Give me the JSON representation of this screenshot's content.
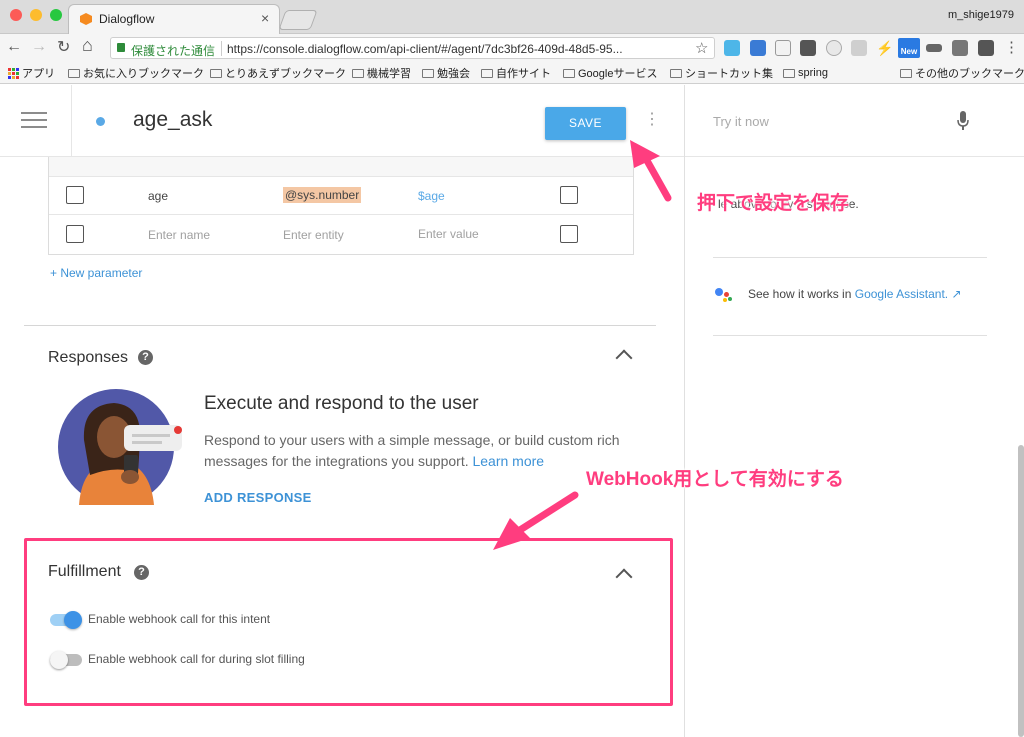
{
  "browser": {
    "tab_title": "Dialogflow",
    "user": "m_shige1979",
    "url_secure_label": "保護された通信",
    "url_text": "https://console.dialogflow.com/api-client/#/agent/7dc3bf26-409d-48d5-95...",
    "bookmarks": [
      "アプリ",
      "お気に入りブックマーク",
      "とりあえずブックマーク",
      "機械学習",
      "勉強会",
      "自作サイト",
      "Googleサービス",
      "ショートカット集",
      "spring",
      "その他のブックマーク"
    ],
    "new_badge": "New"
  },
  "header": {
    "intent_name": "age_ask",
    "save_label": "SAVE"
  },
  "parameters": {
    "rows": [
      {
        "name": "age",
        "entity": "@sys.number",
        "value": "$age"
      },
      {
        "name": "Enter name",
        "entity": "Enter entity",
        "value": "Enter value"
      }
    ],
    "new_parameter_label": "+ New parameter"
  },
  "responses": {
    "title": "Responses",
    "heading": "Execute and respond to the user",
    "description": "Respond to your users with a simple message, or build custom rich messages for the integrations you support.",
    "learn_more": "Learn more",
    "add_response_label": "ADD RESPONSE"
  },
  "fulfillment": {
    "title": "Fulfillment",
    "webhook_label": "Enable webhook call for this intent",
    "slot_label": "Enable webhook call for during slot filling",
    "webhook_enabled": true,
    "slot_enabled": false
  },
  "try_panel": {
    "placeholder": "Try it now",
    "hint_text": "le above to try a sentence.",
    "google_text": "See how it works in",
    "google_link": "Google Assistant."
  },
  "annotations": {
    "save_note": "押下で設定を保存",
    "webhook_note": "WebHook用として有効にする"
  },
  "colors": {
    "accent": "#5aa9e6",
    "save_button": "#4aa8e8",
    "annotation": "#ff3d7f"
  }
}
